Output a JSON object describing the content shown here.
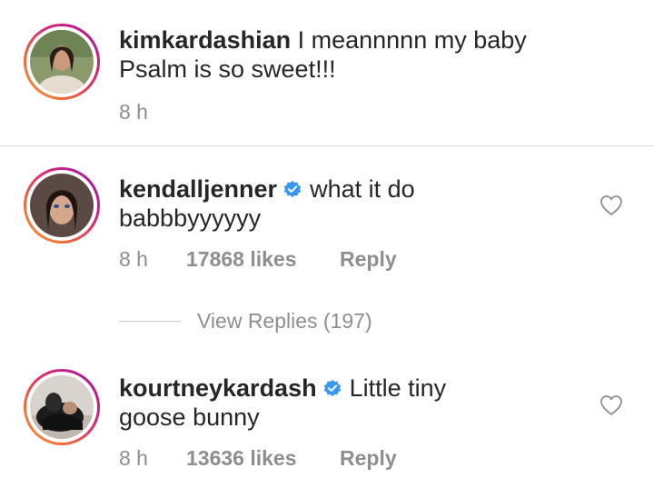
{
  "comments": [
    {
      "username": "kimkardashian",
      "text": "I meannnnn my baby Psalm is so sweet!!!",
      "time": "8 h"
    },
    {
      "username": "kendalljenner",
      "text": "what it do babbbyyyyyy",
      "time": "8 h",
      "likes": "17868 likes",
      "reply": "Reply"
    },
    {
      "username": "kourtneykardash",
      "text": "Little tiny goose bunny",
      "time": "8 h",
      "likes": "13636 likes",
      "reply": "Reply"
    }
  ],
  "view_replies": "View Replies (197)",
  "icons": {
    "verified": "verified-badge-icon",
    "like": "heart-outline-icon"
  },
  "colors": {
    "text": "#262626",
    "secondary": "#8e8e8e",
    "verified": "#3897f0",
    "divider": "#dbdbdb"
  }
}
